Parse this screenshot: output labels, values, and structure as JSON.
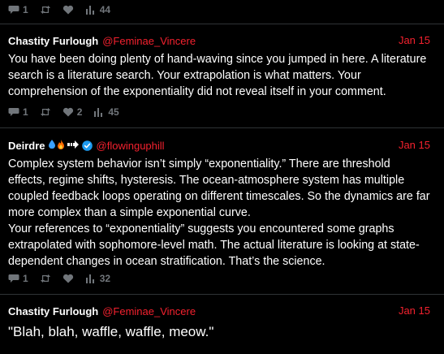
{
  "colors": {
    "background": "#000000",
    "text": "#ffffff",
    "muted": "#71767b",
    "accent": "#f4212e",
    "verified": "#1d9bf0"
  },
  "top_stats": {
    "replies": "1",
    "retweets": "",
    "likes": "",
    "views": "44"
  },
  "tweets": [
    {
      "name": "Chastity Furlough",
      "handle": "@Feminae_Vincere",
      "date": "Jan 15",
      "text": [
        "You have been doing plenty of hand-waving since you jumped in here. A literature search is a literature search. Your extrapolation is what matters. Your comprehension of the exponentiality did not reveal itself in your comment."
      ],
      "stats": {
        "replies": "1",
        "retweets": "",
        "likes": "2",
        "views": "45"
      }
    },
    {
      "name": "Deirdre",
      "name_icons": [
        "droplet-emoji",
        "fire-emoji",
        "arrow-emoji",
        "verified-badge-icon"
      ],
      "handle": "@flowinguphill",
      "date": "Jan 15",
      "text": [
        "Complex system behavior isn’t simply “exponentiality.” There are threshold effects, regime shifts, hysteresis. The ocean-atmosphere system has multiple coupled feedback loops operating on different timescales. So the dynamics are far more complex than a simple exponential curve.",
        "Your references to “exponentiality” suggests you encountered some graphs extrapolated with sophomore-level math. The actual literature is looking at state-dependent changes in ocean stratification. That’s the science."
      ],
      "stats": {
        "replies": "1",
        "retweets": "",
        "likes": "",
        "views": "32"
      }
    },
    {
      "name": "Chastity Furlough",
      "handle": "@Feminae_Vincere",
      "date": "Jan 15",
      "text": [
        "\"Blah, blah, waffle, waffle, meow.\""
      ]
    }
  ]
}
